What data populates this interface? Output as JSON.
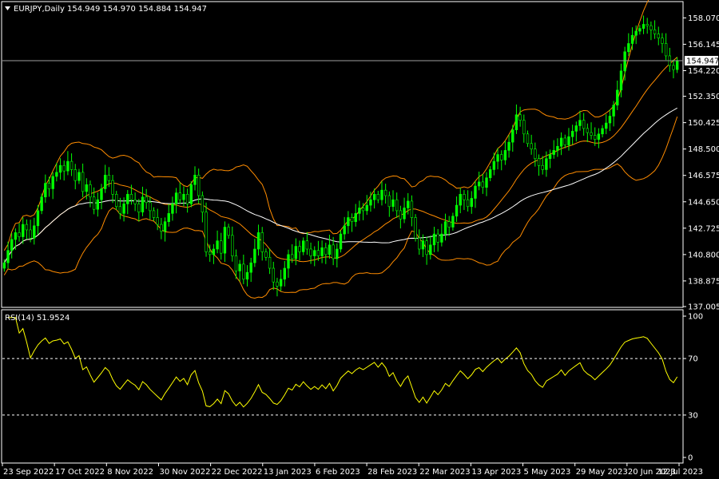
{
  "chart_data": {
    "type": "candlestick",
    "symbol_timeframe": "EURJPY,Daily",
    "ohlc_header": "154.949 154.970 154.884 154.947",
    "last_price_label": "154.947",
    "last_price": 154.947,
    "price_range": [
      137.005,
      159.2
    ],
    "price_ticks": [
      "158.070",
      "156.145",
      "154.220",
      "152.350",
      "150.425",
      "148.500",
      "146.575",
      "144.650",
      "142.725",
      "140.800",
      "138.875",
      "137.005"
    ],
    "date_labels": [
      "23 Sep 2022",
      "17 Oct 2022",
      "8 Nov 2022",
      "30 Nov 2022",
      "22 Dec 2022",
      "13 Jan 2023",
      "6 Feb 2023",
      "28 Feb 2023",
      "22 Mar 2023",
      "13 Apr 2023",
      "5 May 2023",
      "29 May 2023",
      "20 Jun 2023",
      "12 Jul 2023"
    ],
    "closes": [
      140.2,
      141.1,
      141.9,
      142.4,
      142.1,
      143.0,
      142.6,
      142.0,
      142.9,
      144.0,
      145.0,
      146.0,
      145.6,
      146.5,
      146.8,
      147.3,
      146.9,
      147.6,
      147.0,
      146.2,
      146.8,
      145.4,
      145.9,
      145.0,
      144.1,
      144.8,
      145.6,
      146.6,
      146.2,
      145.2,
      144.3,
      143.8,
      144.5,
      145.2,
      144.8,
      144.5,
      143.9,
      145.0,
      144.6,
      144.0,
      143.5,
      143.0,
      142.5,
      143.2,
      143.8,
      144.5,
      145.3,
      144.8,
      145.2,
      144.5,
      145.9,
      146.6,
      145.1,
      143.9,
      141.0,
      140.8,
      141.2,
      141.8,
      140.9,
      142.8,
      142.2,
      140.7,
      139.6,
      140.1,
      139.0,
      139.5,
      140.2,
      141.2,
      142.4,
      141.0,
      140.6,
      139.8,
      138.8,
      138.5,
      139.0,
      139.8,
      140.8,
      140.5,
      141.4,
      141.0,
      141.8,
      141.2,
      140.7,
      141.1,
      140.7,
      141.3,
      140.8,
      141.5,
      140.5,
      141.2,
      142.3,
      142.9,
      143.5,
      143.2,
      143.8,
      144.2,
      144.0,
      144.4,
      144.8,
      145.2,
      144.8,
      145.5,
      145.1,
      144.3,
      144.8,
      144.0,
      143.4,
      144.2,
      144.7,
      143.5,
      142.0,
      141.2,
      141.8,
      140.8,
      141.5,
      142.3,
      141.7,
      142.3,
      143.2,
      142.8,
      143.6,
      144.4,
      145.2,
      144.8,
      144.3,
      144.9,
      145.8,
      146.1,
      145.7,
      146.4,
      147.0,
      147.6,
      148.1,
      147.7,
      148.4,
      149.0,
      149.9,
      151.0,
      150.6,
      149.6,
      148.9,
      148.5,
      147.8,
      147.3,
      147.0,
      147.8,
      148.1,
      148.4,
      148.7,
      149.3,
      148.8,
      149.4,
      149.8,
      150.2,
      150.6,
      150.0,
      149.7,
      149.5,
      149.2,
      149.6,
      150.0,
      150.4,
      150.9,
      151.7,
      152.8,
      154.2,
      155.6,
      156.2,
      156.8,
      157.1,
      157.3,
      157.6,
      157.5,
      157.2,
      156.9,
      156.6,
      156.2,
      155.3,
      154.6,
      154.3,
      154.947
    ],
    "rsi": {
      "label": "RSI(14) 51.9524",
      "period": 14,
      "value": 51.9524,
      "levels": [
        70,
        30
      ],
      "range": [
        0,
        100
      ],
      "ticks": [
        "100",
        "70",
        "30",
        "0"
      ]
    },
    "indicators": [
      "Bollinger Bands",
      "Moving Average"
    ],
    "colors": {
      "bull": "#00ff00",
      "bear": "#ffffff",
      "bollinger": "#ff8c00",
      "moving_average": "#ffffff",
      "rsi": "#ffff00",
      "background": "#000000"
    }
  }
}
